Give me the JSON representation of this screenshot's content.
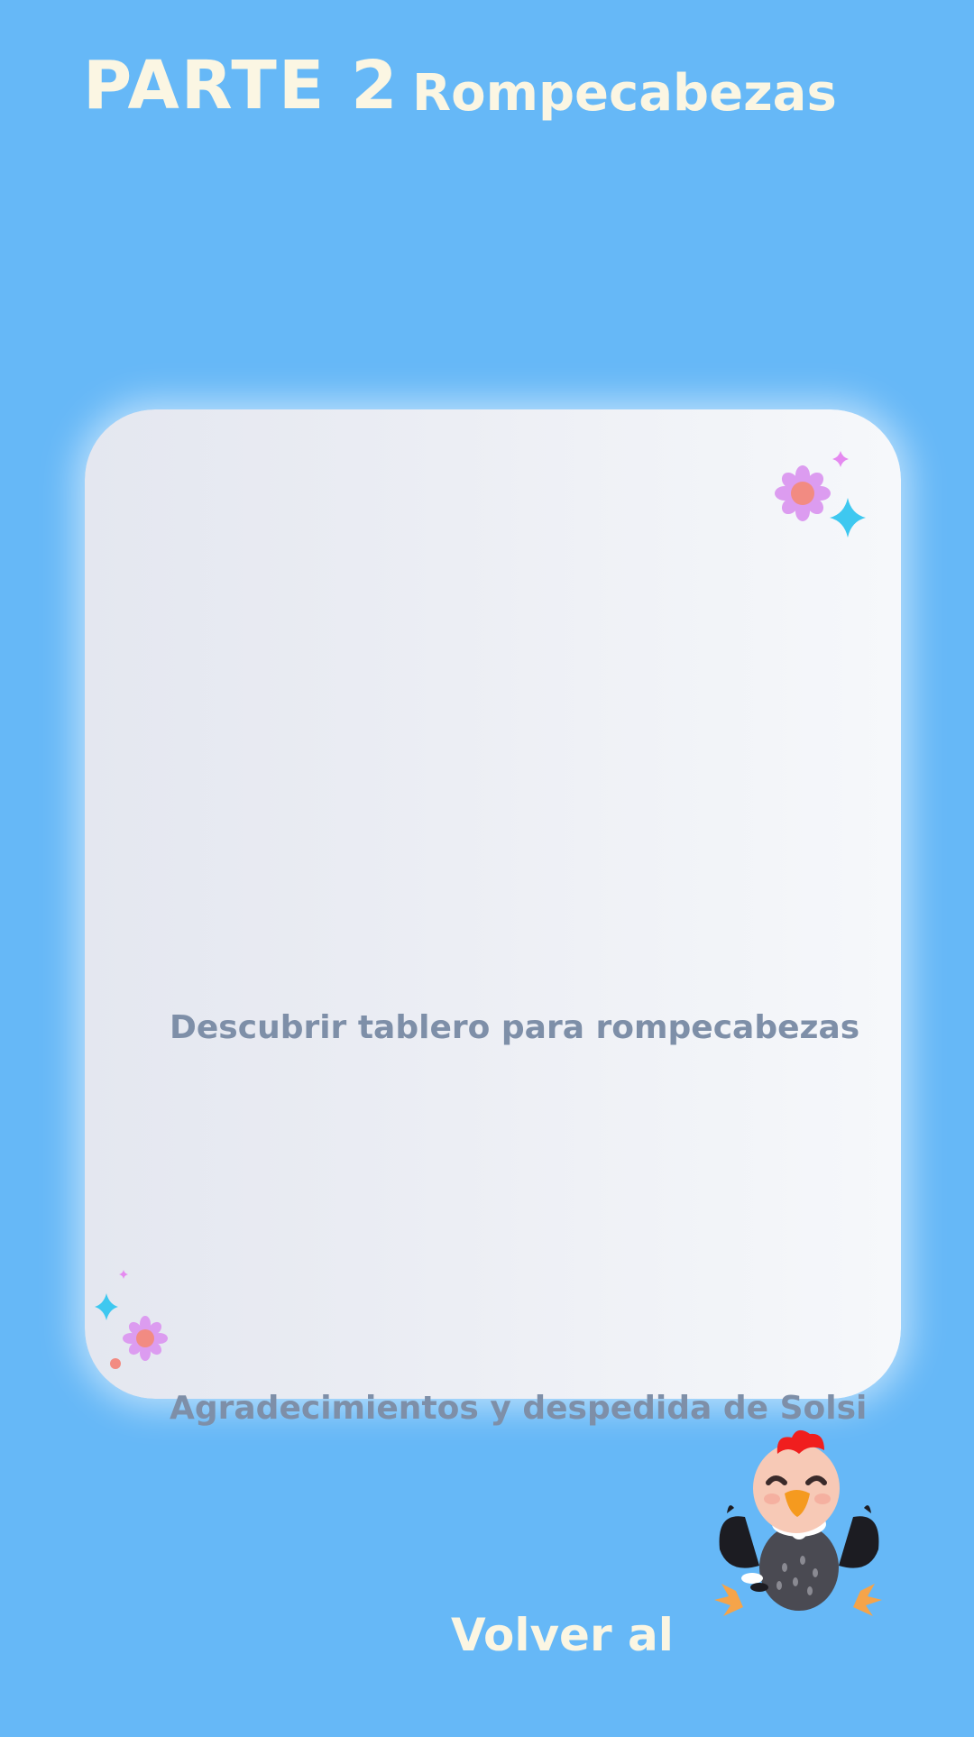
{
  "header": {
    "part_label": "PARTE 2",
    "section_title": "Rompecabezas"
  },
  "menu": {
    "items": [
      {
        "label": "Descubrir tablero para rompecabezas"
      },
      {
        "label": "Agradecimientos y despedida de Solsi"
      }
    ]
  },
  "footer": {
    "back_label": "Volver al"
  },
  "icons": {
    "card_top_right": [
      "flower-icon",
      "sparkle-icon"
    ],
    "card_bottom_left": [
      "flower-icon",
      "sparkle-icon",
      "dot-icon"
    ],
    "mascot": "condor-chick-mascot"
  },
  "colors": {
    "background": "#66b8f7",
    "title": "#fbf6e3",
    "menu_text": "#7e8fa8",
    "flower_petal": "#dc9cf0",
    "flower_center": "#f28b82",
    "sparkle_cyan": "#3ec8f0",
    "sparkle_pink": "#e58af0"
  }
}
